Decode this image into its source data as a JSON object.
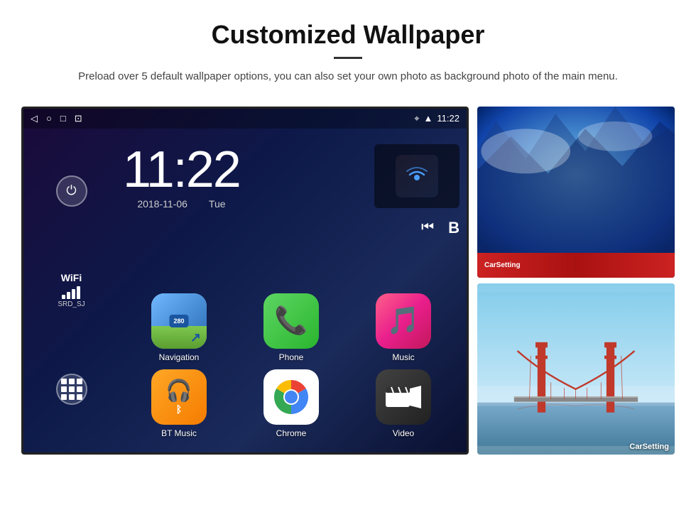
{
  "header": {
    "title": "Customized Wallpaper",
    "subtitle": "Preload over 5 default wallpaper options, you can also set your own photo as background photo of the main menu."
  },
  "android": {
    "status_bar": {
      "time": "11:22",
      "icons_left": [
        "back",
        "home",
        "square",
        "image"
      ]
    },
    "clock": {
      "time": "11:22",
      "date": "2018-11-06",
      "day": "Tue"
    },
    "wifi": {
      "label": "WiFi",
      "ssid": "SRD_SJ"
    },
    "apps": [
      {
        "name": "Navigation",
        "label": "Navigation",
        "type": "nav"
      },
      {
        "name": "Phone",
        "label": "Phone",
        "type": "phone"
      },
      {
        "name": "Music",
        "label": "Music",
        "type": "music"
      },
      {
        "name": "BT Music",
        "label": "BT Music",
        "type": "bt"
      },
      {
        "name": "Chrome",
        "label": "Chrome",
        "type": "chrome"
      },
      {
        "name": "Video",
        "label": "Video",
        "type": "video"
      }
    ]
  },
  "panels": {
    "top_label": "CarSetting",
    "bottom_label": "CarSetting"
  }
}
